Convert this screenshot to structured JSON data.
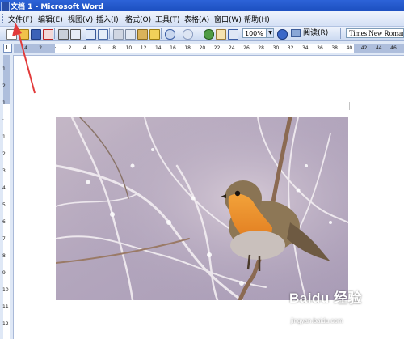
{
  "window": {
    "title": "文档 1 - Microsoft Word"
  },
  "menu": {
    "items": [
      "文件(F)",
      "编辑(E)",
      "视图(V)",
      "插入(I)",
      "格式(O)",
      "工具(T)",
      "表格(A)",
      "窗口(W)",
      "帮助(H)"
    ]
  },
  "toolbar": {
    "zoom": "100%",
    "read_label": "阅读(R)",
    "font_name": "Times New Roman",
    "icons": [
      "new-document-icon",
      "open-icon",
      "save-icon",
      "permission-icon",
      "print-icon",
      "print-preview-icon",
      "spelling-icon",
      "research-icon",
      "cut-icon",
      "copy-icon",
      "paste-icon",
      "format-painter-icon",
      "undo-icon",
      "redo-icon",
      "hyperlink-icon",
      "tables-borders-icon",
      "insert-table-icon",
      "help-icon"
    ]
  },
  "ruler": {
    "h_ticks": [
      "4",
      "2",
      "",
      "2",
      "4",
      "6",
      "8",
      "10",
      "12",
      "14",
      "16",
      "18",
      "20",
      "22",
      "24",
      "26",
      "28",
      "30",
      "32",
      "34",
      "36",
      "38",
      "40",
      "42",
      "44",
      "46"
    ],
    "v_ticks": [
      "1",
      "2",
      "1",
      "",
      "1",
      "2",
      "3",
      "4",
      "5",
      "6",
      "7",
      "8",
      "9",
      "10",
      "11",
      "12"
    ]
  },
  "watermark": {
    "brand": "Baidu 经验",
    "url": "jingyan.baidu.com"
  },
  "colors": {
    "accent": "#e23b3b",
    "titlebar": "#1c4fbf"
  }
}
